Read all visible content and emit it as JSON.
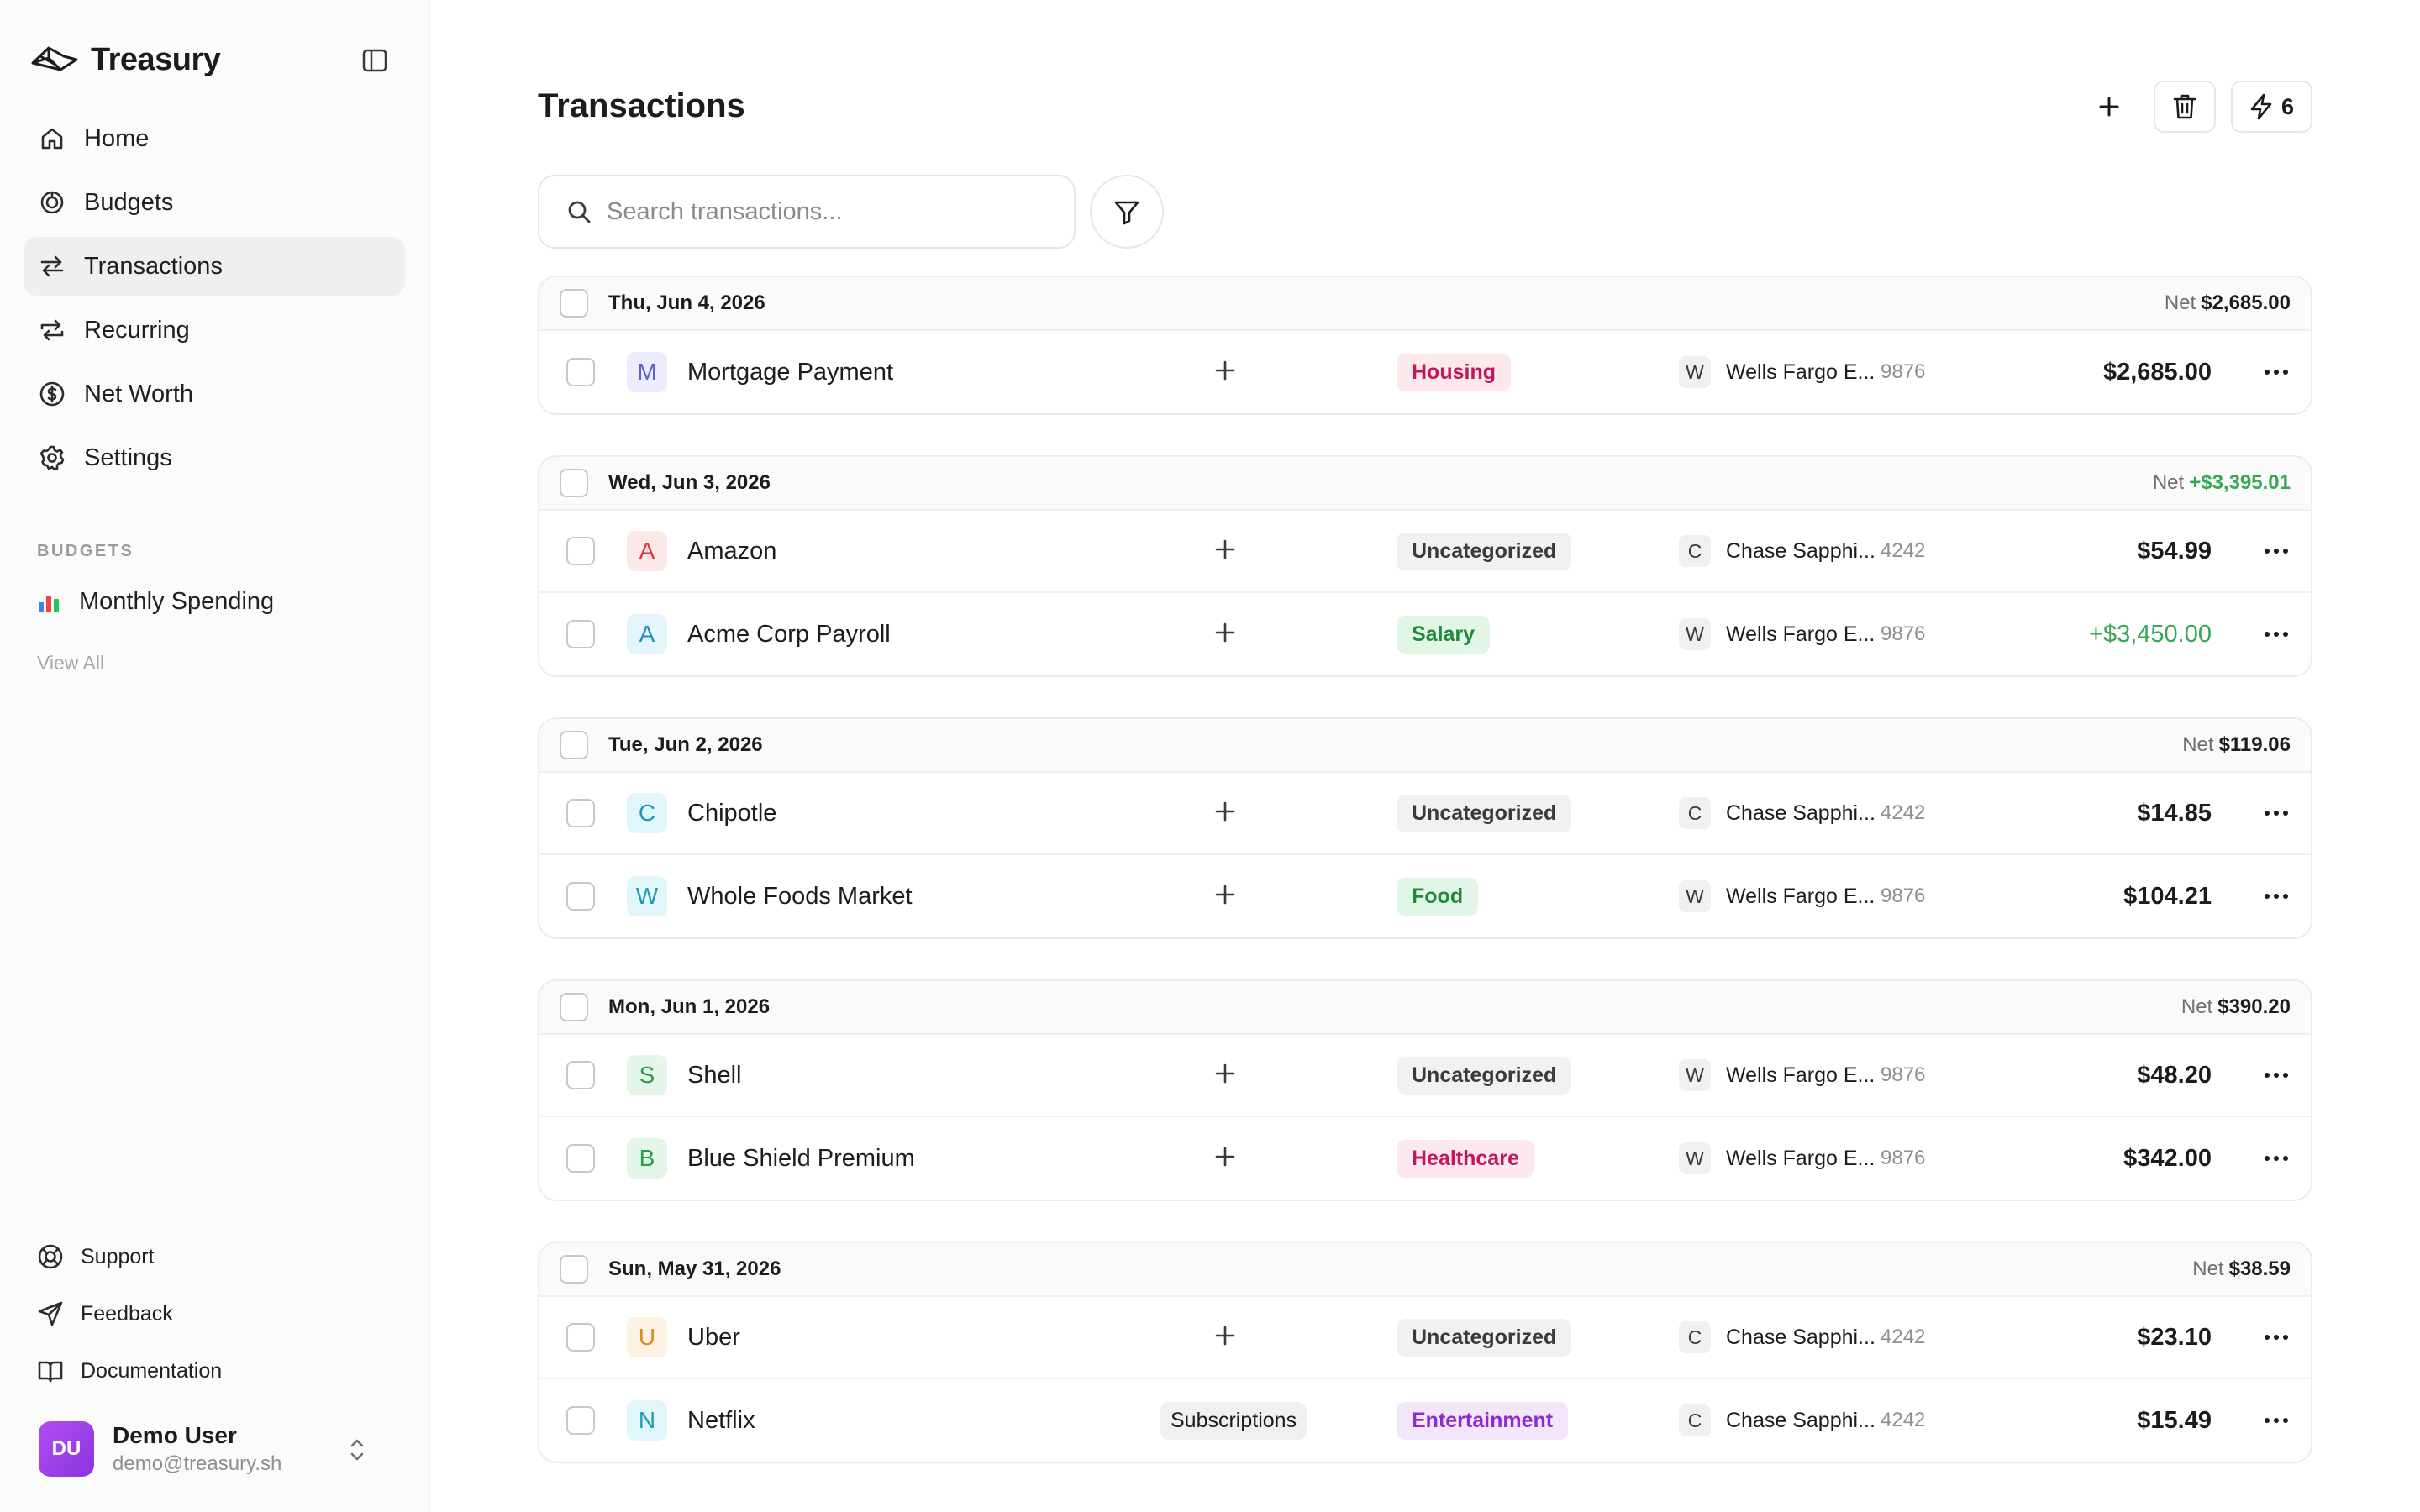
{
  "app": {
    "title": "Treasury"
  },
  "sidebar": {
    "nav": [
      {
        "label": "Home",
        "icon": "home-icon"
      },
      {
        "label": "Budgets",
        "icon": "budgets-icon"
      },
      {
        "label": "Transactions",
        "icon": "transactions-icon",
        "active": true
      },
      {
        "label": "Recurring",
        "icon": "recurring-icon"
      },
      {
        "label": "Net Worth",
        "icon": "net-worth-icon"
      },
      {
        "label": "Settings",
        "icon": "gear-icon"
      }
    ],
    "budgets_label": "BUDGETS",
    "budget_item": "Monthly Spending",
    "view_all": "View All",
    "footer": [
      {
        "label": "Support",
        "icon": "lifebuoy-icon"
      },
      {
        "label": "Feedback",
        "icon": "send-icon"
      },
      {
        "label": "Documentation",
        "icon": "book-icon"
      }
    ],
    "user": {
      "initials": "DU",
      "name": "Demo User",
      "email": "demo@treasury.sh"
    }
  },
  "header": {
    "title": "Transactions",
    "automations_count": "6"
  },
  "search": {
    "placeholder": "Search transactions..."
  },
  "colors": {
    "positive": "#34a853",
    "accent": "#9b3ee8"
  },
  "groups": [
    {
      "date": "Thu, Jun 4, 2026",
      "net_label": "Net",
      "net": "$2,685.00",
      "net_positive": false,
      "rows": [
        {
          "initial": "M",
          "merchant": "Mortgage Payment",
          "category": "Housing",
          "account_letter": "W",
          "account": "Wells Fargo E...",
          "mask": "9876",
          "amount": "$2,685.00",
          "positive": false
        }
      ]
    },
    {
      "date": "Wed, Jun 3, 2026",
      "net_label": "Net",
      "net": "+$3,395.01",
      "net_positive": true,
      "rows": [
        {
          "initial": "A",
          "merchant": "Amazon",
          "category": "Uncategorized",
          "account_letter": "C",
          "account": "Chase Sapphi...",
          "mask": "4242",
          "amount": "$54.99",
          "positive": false
        },
        {
          "initial": "A",
          "merchant": "Acme Corp Payroll",
          "category": "Salary",
          "account_letter": "W",
          "account": "Wells Fargo E...",
          "mask": "9876",
          "amount": "+$3,450.00",
          "positive": true
        }
      ]
    },
    {
      "date": "Tue, Jun 2, 2026",
      "net_label": "Net",
      "net": "$119.06",
      "net_positive": false,
      "rows": [
        {
          "initial": "C",
          "merchant": "Chipotle",
          "category": "Uncategorized",
          "account_letter": "C",
          "account": "Chase Sapphi...",
          "mask": "4242",
          "amount": "$14.85",
          "positive": false
        },
        {
          "initial": "W",
          "merchant": "Whole Foods Market",
          "category": "Food",
          "account_letter": "W",
          "account": "Wells Fargo E...",
          "mask": "9876",
          "amount": "$104.21",
          "positive": false
        }
      ]
    },
    {
      "date": "Mon, Jun 1, 2026",
      "net_label": "Net",
      "net": "$390.20",
      "net_positive": false,
      "rows": [
        {
          "initial": "S",
          "merchant": "Shell",
          "category": "Uncategorized",
          "account_letter": "W",
          "account": "Wells Fargo E...",
          "mask": "9876",
          "amount": "$48.20",
          "positive": false
        },
        {
          "initial": "B",
          "merchant": "Blue Shield Premium",
          "category": "Healthcare",
          "account_letter": "W",
          "account": "Wells Fargo E...",
          "mask": "9876",
          "amount": "$342.00",
          "positive": false
        }
      ]
    },
    {
      "date": "Sun, May 31, 2026",
      "net_label": "Net",
      "net": "$38.59",
      "net_positive": false,
      "rows": [
        {
          "initial": "U",
          "merchant": "Uber",
          "category": "Uncategorized",
          "account_letter": "C",
          "account": "Chase Sapphi...",
          "mask": "4242",
          "amount": "$23.10",
          "positive": false
        },
        {
          "initial": "N",
          "merchant": "Netflix",
          "tag": "Subscriptions",
          "category": "Entertainment",
          "account_letter": "C",
          "account": "Chase Sapphi...",
          "mask": "4242",
          "amount": "$15.49",
          "positive": false
        }
      ]
    }
  ]
}
